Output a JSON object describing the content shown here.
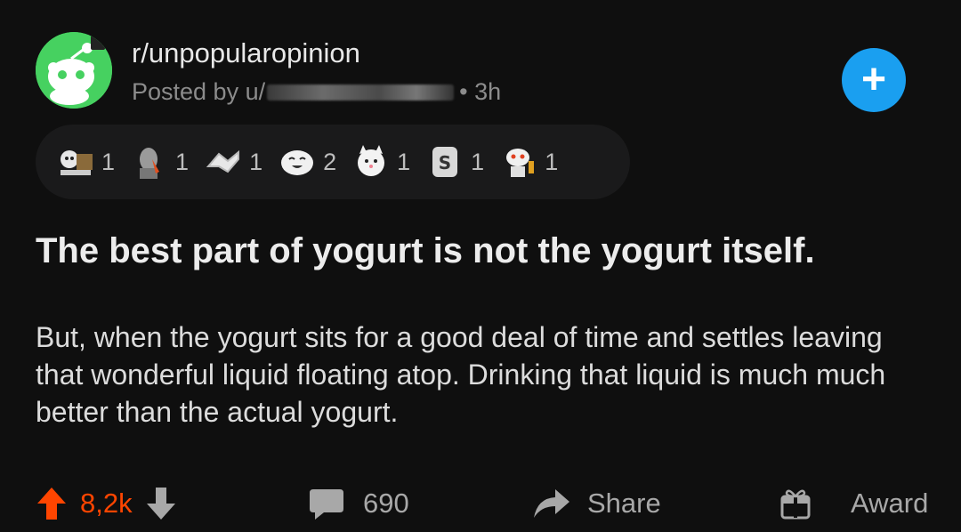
{
  "post": {
    "subreddit": "r/unpopularopinion",
    "posted_by_prefix": "Posted by u/",
    "time_ago": "• 3h",
    "join_label": "+",
    "title": "The best part of yogurt is not the yogurt itself.",
    "body": "But, when the yogurt sits for a good deal of time and settles leaving that wonderful liquid floating atop. Drinking that liquid is much much better than the actual yogurt."
  },
  "awards": [
    {
      "icon": "wholesome-award-icon",
      "count": "1"
    },
    {
      "icon": "facepalm-award-icon",
      "count": "1"
    },
    {
      "icon": "handshake-award-icon",
      "count": "1"
    },
    {
      "icon": "laughing-award-icon",
      "count": "2"
    },
    {
      "icon": "cat-award-icon",
      "count": "1"
    },
    {
      "icon": "silver-award-icon",
      "count": "1"
    },
    {
      "icon": "snoo-cheers-award-icon",
      "count": "1"
    }
  ],
  "actions": {
    "upvotes": "8,2k",
    "comments": "690",
    "share_label": "Share",
    "award_label": "Award"
  },
  "colors": {
    "background": "#0f0f0f",
    "upvote": "#ff4500",
    "join_button": "#1a9ff0",
    "avatar": "#46d160"
  }
}
